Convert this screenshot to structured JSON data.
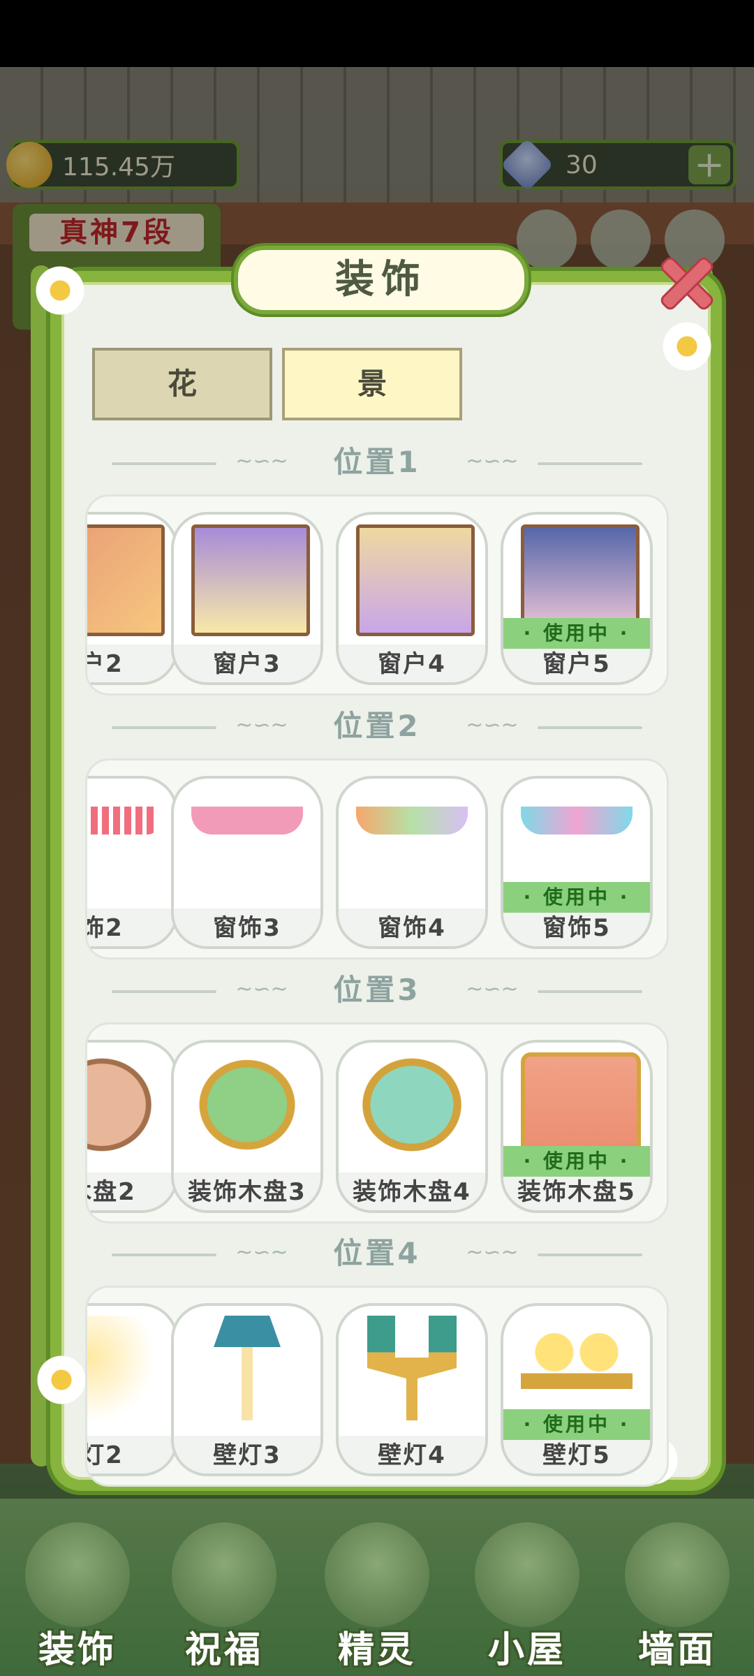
{
  "hud": {
    "money": "115.45万",
    "gems": "30",
    "plus": "+",
    "rank": "真神7段"
  },
  "modal": {
    "title": "装饰",
    "close": "×",
    "tabs": [
      {
        "label": "花",
        "active": false
      },
      {
        "label": "景",
        "active": true
      }
    ],
    "in_use_label": "· 使用中 ·",
    "sections": [
      {
        "title": "位置1",
        "items": [
          {
            "label": "户2",
            "img": "win2",
            "in_use": false
          },
          {
            "label": "窗户3",
            "img": "win3",
            "in_use": false
          },
          {
            "label": "窗户4",
            "img": "win4",
            "in_use": false
          },
          {
            "label": "窗户5",
            "img": "win5",
            "in_use": true
          }
        ]
      },
      {
        "title": "位置2",
        "items": [
          {
            "label": "饰2",
            "img": "cur2",
            "in_use": false
          },
          {
            "label": "窗饰3",
            "img": "cur3",
            "in_use": false
          },
          {
            "label": "窗饰4",
            "img": "cur4",
            "in_use": false
          },
          {
            "label": "窗饰5",
            "img": "cur5",
            "in_use": true
          }
        ]
      },
      {
        "title": "位置3",
        "items": [
          {
            "label": "木盘2",
            "img": "tray2",
            "in_use": false
          },
          {
            "label": "装饰木盘3",
            "img": "tray3",
            "in_use": false
          },
          {
            "label": "装饰木盘4",
            "img": "tray4",
            "in_use": false
          },
          {
            "label": "装饰木盘5",
            "img": "tray5",
            "in_use": true
          }
        ]
      },
      {
        "title": "位置4",
        "items": [
          {
            "label": "灯2",
            "img": "lamp2",
            "in_use": false
          },
          {
            "label": "壁灯3",
            "img": "lamp3",
            "in_use": false
          },
          {
            "label": "壁灯4",
            "img": "lamp4",
            "in_use": false
          },
          {
            "label": "壁灯5",
            "img": "lamp5",
            "in_use": true
          }
        ]
      }
    ]
  },
  "bottom_nav": [
    {
      "label": "装饰",
      "icon": "plant-icon"
    },
    {
      "label": "祝福",
      "icon": "vase-icon"
    },
    {
      "label": "精灵",
      "icon": "fairy-icon"
    },
    {
      "label": "小屋",
      "icon": "house-icon"
    },
    {
      "label": "墙面",
      "icon": "bell-icon"
    }
  ],
  "colors": {
    "frame": "#86b43c",
    "in_use": "#8bd07d",
    "close": "#e06a72"
  }
}
